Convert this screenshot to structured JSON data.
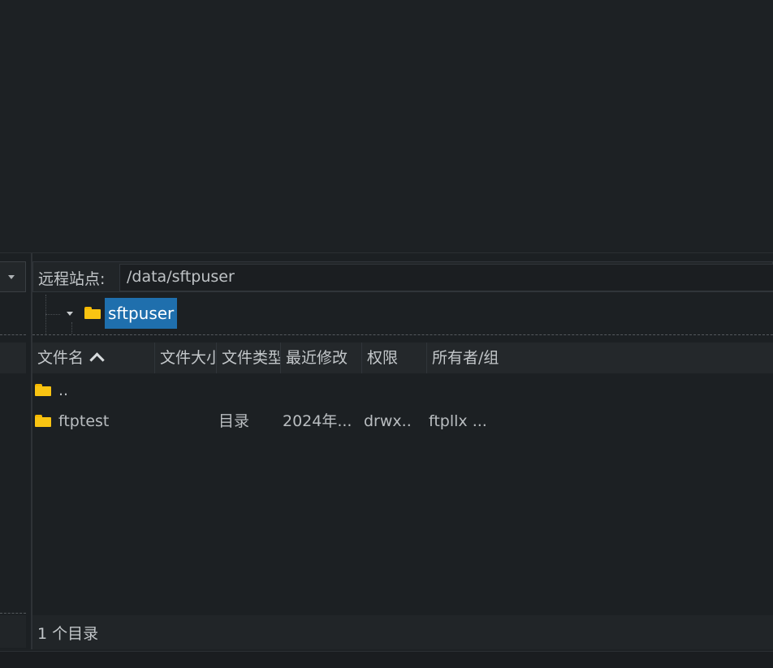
{
  "remote": {
    "site_label": "远程站点:",
    "path": "/data/sftpuser",
    "tree": {
      "selected_folder": "sftpuser"
    },
    "columns": {
      "name": "文件名",
      "size": "文件大小",
      "type": "文件类型",
      "modified": "最近修改",
      "permissions": "权限",
      "owner": "所有者/组"
    },
    "rows": [
      {
        "name": "..",
        "type": "",
        "modified": "",
        "permissions": "",
        "owner": ""
      },
      {
        "name": "ftptest",
        "type": "目录",
        "modified": "2024年...",
        "permissions": "drwx..",
        "owner": "ftpllx ..."
      }
    ],
    "status": "1 个目录"
  },
  "colors": {
    "background": "#1d2124",
    "selection": "#1f6fad",
    "folder": "#f9c412"
  }
}
